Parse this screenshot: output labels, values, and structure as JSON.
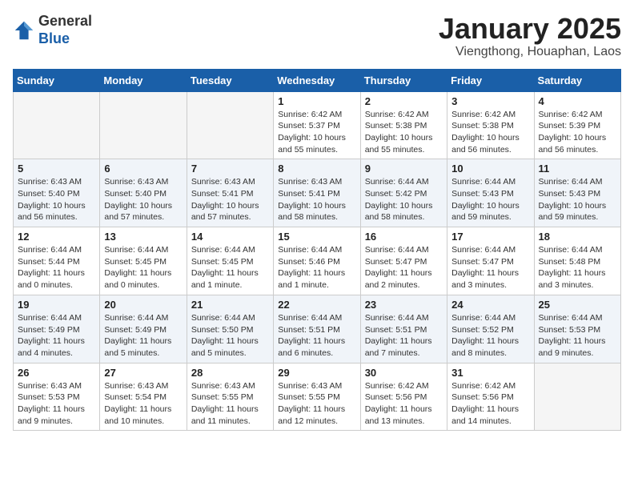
{
  "header": {
    "logo_general": "General",
    "logo_blue": "Blue",
    "month_title": "January 2025",
    "location": "Viengthong, Houaphan, Laos"
  },
  "weekdays": [
    "Sunday",
    "Monday",
    "Tuesday",
    "Wednesday",
    "Thursday",
    "Friday",
    "Saturday"
  ],
  "weeks": [
    [
      {
        "day": "",
        "info": ""
      },
      {
        "day": "",
        "info": ""
      },
      {
        "day": "",
        "info": ""
      },
      {
        "day": "1",
        "info": "Sunrise: 6:42 AM\nSunset: 5:37 PM\nDaylight: 10 hours\nand 55 minutes."
      },
      {
        "day": "2",
        "info": "Sunrise: 6:42 AM\nSunset: 5:38 PM\nDaylight: 10 hours\nand 55 minutes."
      },
      {
        "day": "3",
        "info": "Sunrise: 6:42 AM\nSunset: 5:38 PM\nDaylight: 10 hours\nand 56 minutes."
      },
      {
        "day": "4",
        "info": "Sunrise: 6:42 AM\nSunset: 5:39 PM\nDaylight: 10 hours\nand 56 minutes."
      }
    ],
    [
      {
        "day": "5",
        "info": "Sunrise: 6:43 AM\nSunset: 5:40 PM\nDaylight: 10 hours\nand 56 minutes."
      },
      {
        "day": "6",
        "info": "Sunrise: 6:43 AM\nSunset: 5:40 PM\nDaylight: 10 hours\nand 57 minutes."
      },
      {
        "day": "7",
        "info": "Sunrise: 6:43 AM\nSunset: 5:41 PM\nDaylight: 10 hours\nand 57 minutes."
      },
      {
        "day": "8",
        "info": "Sunrise: 6:43 AM\nSunset: 5:41 PM\nDaylight: 10 hours\nand 58 minutes."
      },
      {
        "day": "9",
        "info": "Sunrise: 6:44 AM\nSunset: 5:42 PM\nDaylight: 10 hours\nand 58 minutes."
      },
      {
        "day": "10",
        "info": "Sunrise: 6:44 AM\nSunset: 5:43 PM\nDaylight: 10 hours\nand 59 minutes."
      },
      {
        "day": "11",
        "info": "Sunrise: 6:44 AM\nSunset: 5:43 PM\nDaylight: 10 hours\nand 59 minutes."
      }
    ],
    [
      {
        "day": "12",
        "info": "Sunrise: 6:44 AM\nSunset: 5:44 PM\nDaylight: 11 hours\nand 0 minutes."
      },
      {
        "day": "13",
        "info": "Sunrise: 6:44 AM\nSunset: 5:45 PM\nDaylight: 11 hours\nand 0 minutes."
      },
      {
        "day": "14",
        "info": "Sunrise: 6:44 AM\nSunset: 5:45 PM\nDaylight: 11 hours\nand 1 minute."
      },
      {
        "day": "15",
        "info": "Sunrise: 6:44 AM\nSunset: 5:46 PM\nDaylight: 11 hours\nand 1 minute."
      },
      {
        "day": "16",
        "info": "Sunrise: 6:44 AM\nSunset: 5:47 PM\nDaylight: 11 hours\nand 2 minutes."
      },
      {
        "day": "17",
        "info": "Sunrise: 6:44 AM\nSunset: 5:47 PM\nDaylight: 11 hours\nand 3 minutes."
      },
      {
        "day": "18",
        "info": "Sunrise: 6:44 AM\nSunset: 5:48 PM\nDaylight: 11 hours\nand 3 minutes."
      }
    ],
    [
      {
        "day": "19",
        "info": "Sunrise: 6:44 AM\nSunset: 5:49 PM\nDaylight: 11 hours\nand 4 minutes."
      },
      {
        "day": "20",
        "info": "Sunrise: 6:44 AM\nSunset: 5:49 PM\nDaylight: 11 hours\nand 5 minutes."
      },
      {
        "day": "21",
        "info": "Sunrise: 6:44 AM\nSunset: 5:50 PM\nDaylight: 11 hours\nand 5 minutes."
      },
      {
        "day": "22",
        "info": "Sunrise: 6:44 AM\nSunset: 5:51 PM\nDaylight: 11 hours\nand 6 minutes."
      },
      {
        "day": "23",
        "info": "Sunrise: 6:44 AM\nSunset: 5:51 PM\nDaylight: 11 hours\nand 7 minutes."
      },
      {
        "day": "24",
        "info": "Sunrise: 6:44 AM\nSunset: 5:52 PM\nDaylight: 11 hours\nand 8 minutes."
      },
      {
        "day": "25",
        "info": "Sunrise: 6:44 AM\nSunset: 5:53 PM\nDaylight: 11 hours\nand 9 minutes."
      }
    ],
    [
      {
        "day": "26",
        "info": "Sunrise: 6:43 AM\nSunset: 5:53 PM\nDaylight: 11 hours\nand 9 minutes."
      },
      {
        "day": "27",
        "info": "Sunrise: 6:43 AM\nSunset: 5:54 PM\nDaylight: 11 hours\nand 10 minutes."
      },
      {
        "day": "28",
        "info": "Sunrise: 6:43 AM\nSunset: 5:55 PM\nDaylight: 11 hours\nand 11 minutes."
      },
      {
        "day": "29",
        "info": "Sunrise: 6:43 AM\nSunset: 5:55 PM\nDaylight: 11 hours\nand 12 minutes."
      },
      {
        "day": "30",
        "info": "Sunrise: 6:42 AM\nSunset: 5:56 PM\nDaylight: 11 hours\nand 13 minutes."
      },
      {
        "day": "31",
        "info": "Sunrise: 6:42 AM\nSunset: 5:56 PM\nDaylight: 11 hours\nand 14 minutes."
      },
      {
        "day": "",
        "info": ""
      }
    ]
  ]
}
